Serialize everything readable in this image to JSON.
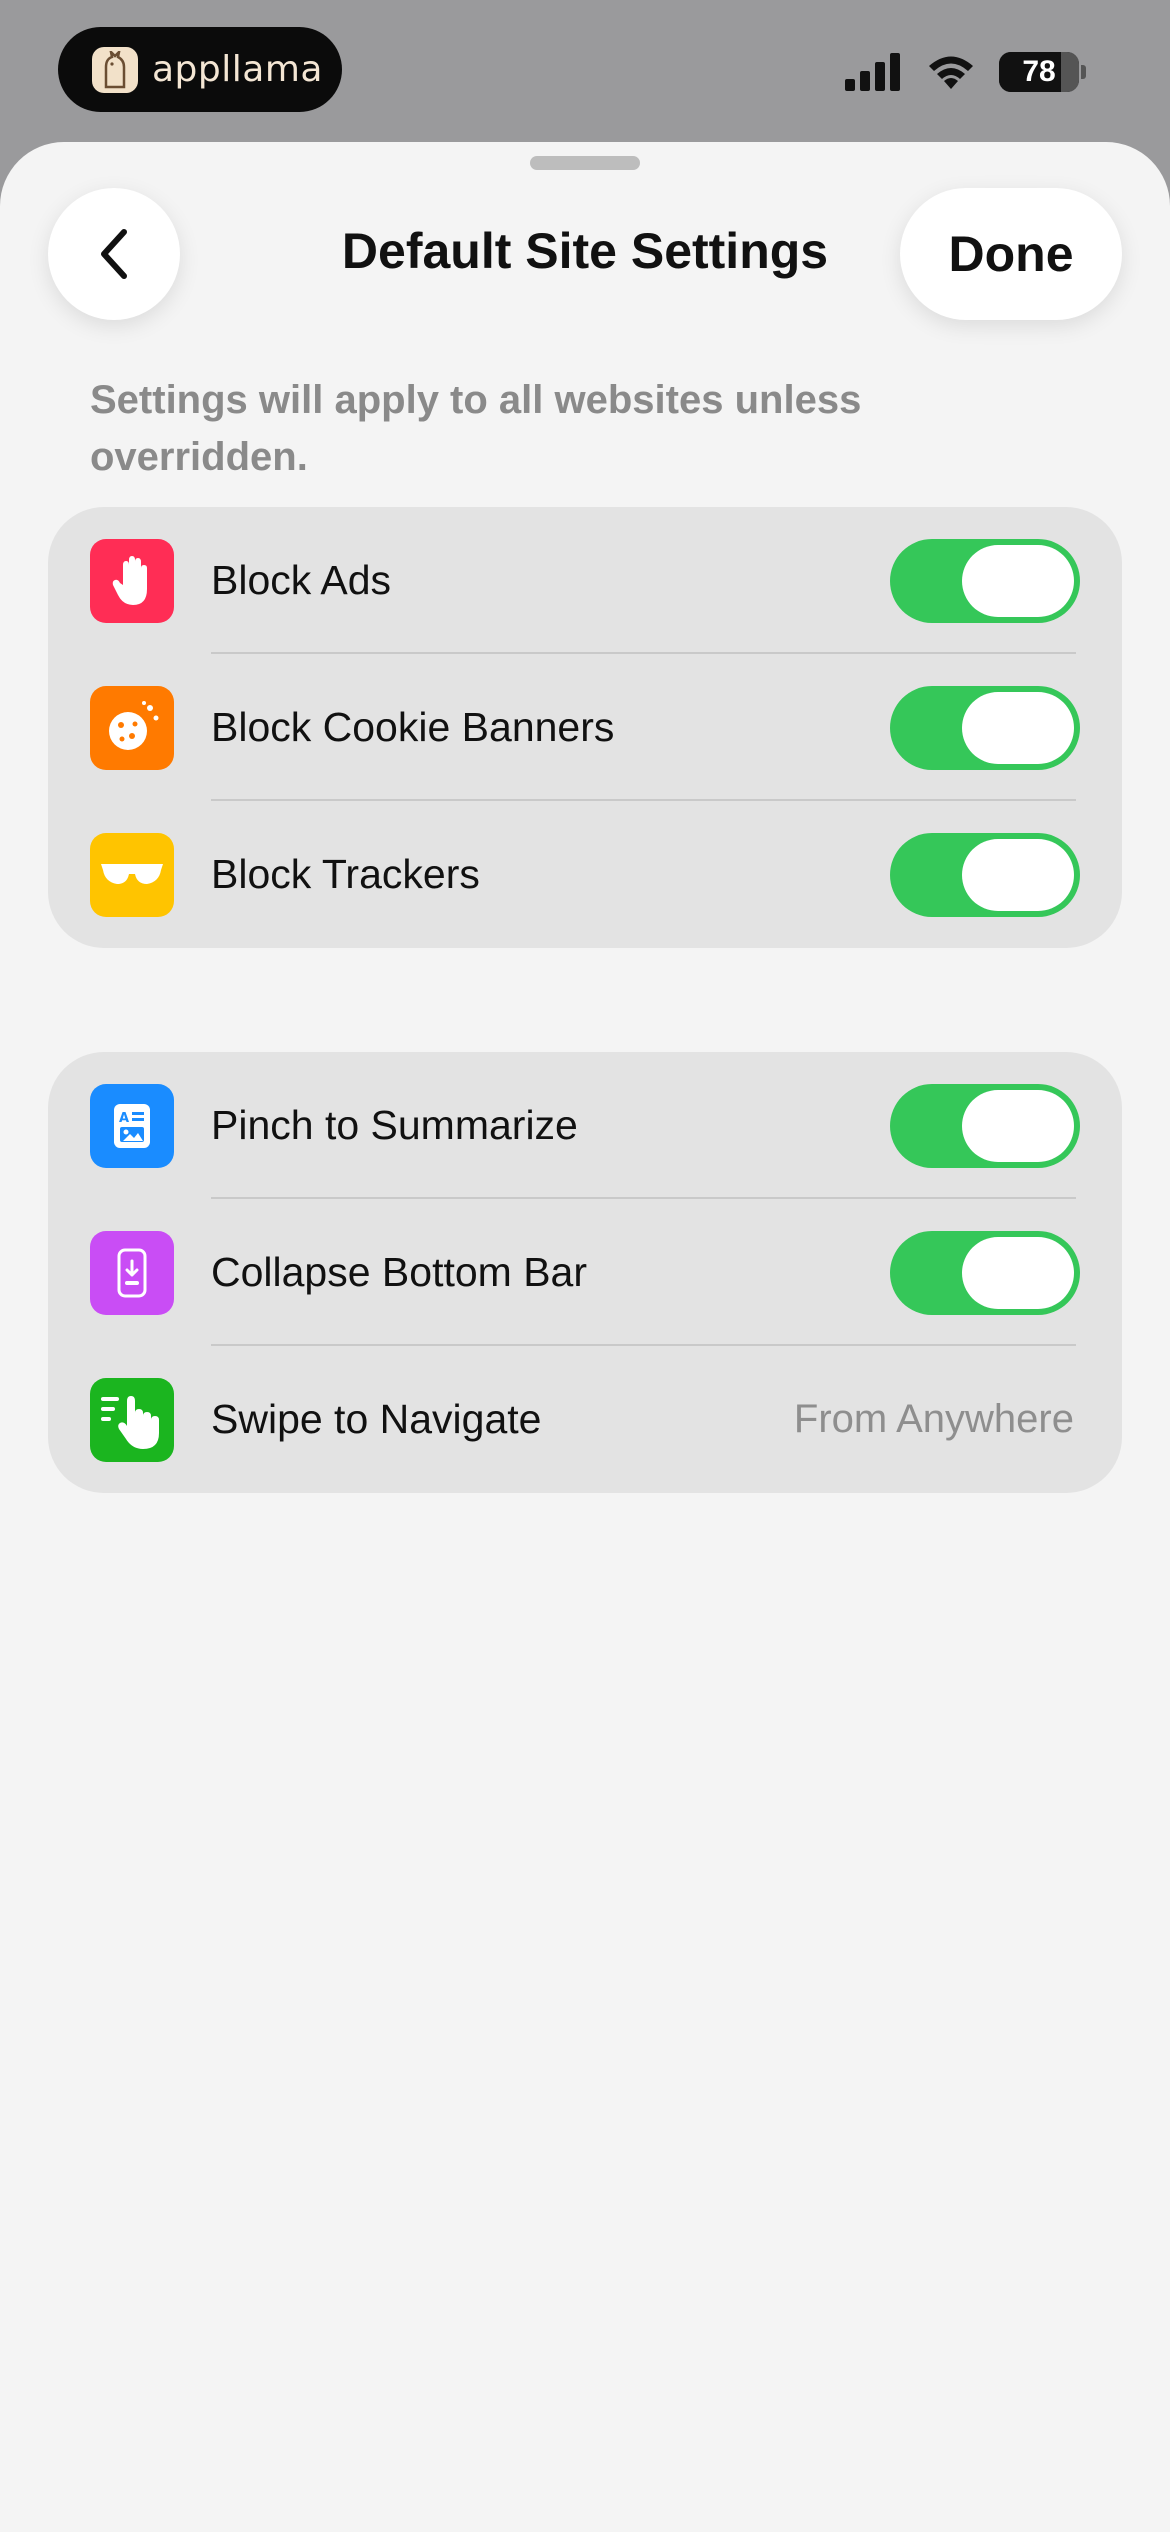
{
  "status": {
    "brand": "appllama",
    "battery": "78",
    "battery_level": 0.78
  },
  "header": {
    "title": "Default Site Settings",
    "done_label": "Done"
  },
  "subtitle": "Settings will apply to all websites unless overridden.",
  "group1": [
    {
      "label": "Block Ads",
      "icon": "hand-raised-icon",
      "color": "#FF2D55",
      "on": true
    },
    {
      "label": "Block Cookie Banners",
      "icon": "cookie-icon",
      "color": "#FF7A00",
      "on": true
    },
    {
      "label": "Block Trackers",
      "icon": "sunglasses-icon",
      "color": "#FFC400",
      "on": true
    }
  ],
  "group2": [
    {
      "label": "Pinch to Summarize",
      "icon": "summary-doc-icon",
      "color": "#1A8CFF",
      "on": true
    },
    {
      "label": "Collapse Bottom Bar",
      "icon": "phone-collapse-icon",
      "color": "#C94DF5",
      "on": true
    },
    {
      "label": "Swipe to Navigate",
      "icon": "swipe-hand-icon",
      "color": "#1BB51F",
      "value": "From Anywhere"
    }
  ],
  "colors": {
    "toggle_on": "#35C759",
    "sheet_bg": "#F4F4F4",
    "group_bg": "#E3E3E3"
  }
}
